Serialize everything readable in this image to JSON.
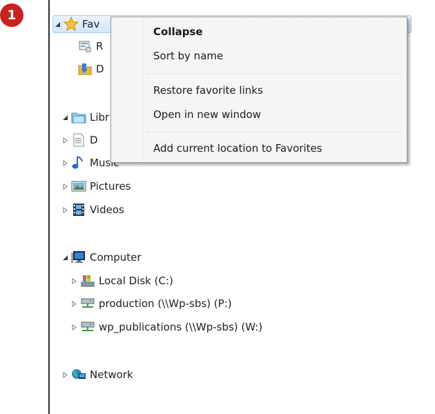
{
  "step_badge": "1",
  "tree": {
    "favorites": {
      "label": "Favorites",
      "visible_label": "Fav"
    },
    "favorites_children": [
      {
        "visible_label": "R"
      },
      {
        "visible_label": "D"
      }
    ],
    "libraries": {
      "visible_label": "Libr"
    },
    "libraries_children": [
      {
        "visible_label": "D"
      },
      {
        "label": "Music"
      },
      {
        "label": "Pictures"
      },
      {
        "label": "Videos"
      }
    ],
    "computer": {
      "label": "Computer"
    },
    "computer_children": [
      {
        "label": "Local Disk (C:)"
      },
      {
        "label": "production (\\\\Wp-sbs) (P:)"
      },
      {
        "label": "wp_publications (\\\\Wp-sbs) (W:)"
      }
    ],
    "network": {
      "label": "Network"
    }
  },
  "context_menu": {
    "items": [
      {
        "label": "Collapse",
        "default": true
      },
      {
        "label": "Sort by name"
      },
      {
        "label": "Restore favorite links"
      },
      {
        "label": "Open in new window"
      },
      {
        "label": "Add current location to Favorites"
      }
    ]
  },
  "colors": {
    "badge": "#c9231e",
    "selection": "#d3e6fb",
    "menu_bg": "#f5f5f5"
  }
}
